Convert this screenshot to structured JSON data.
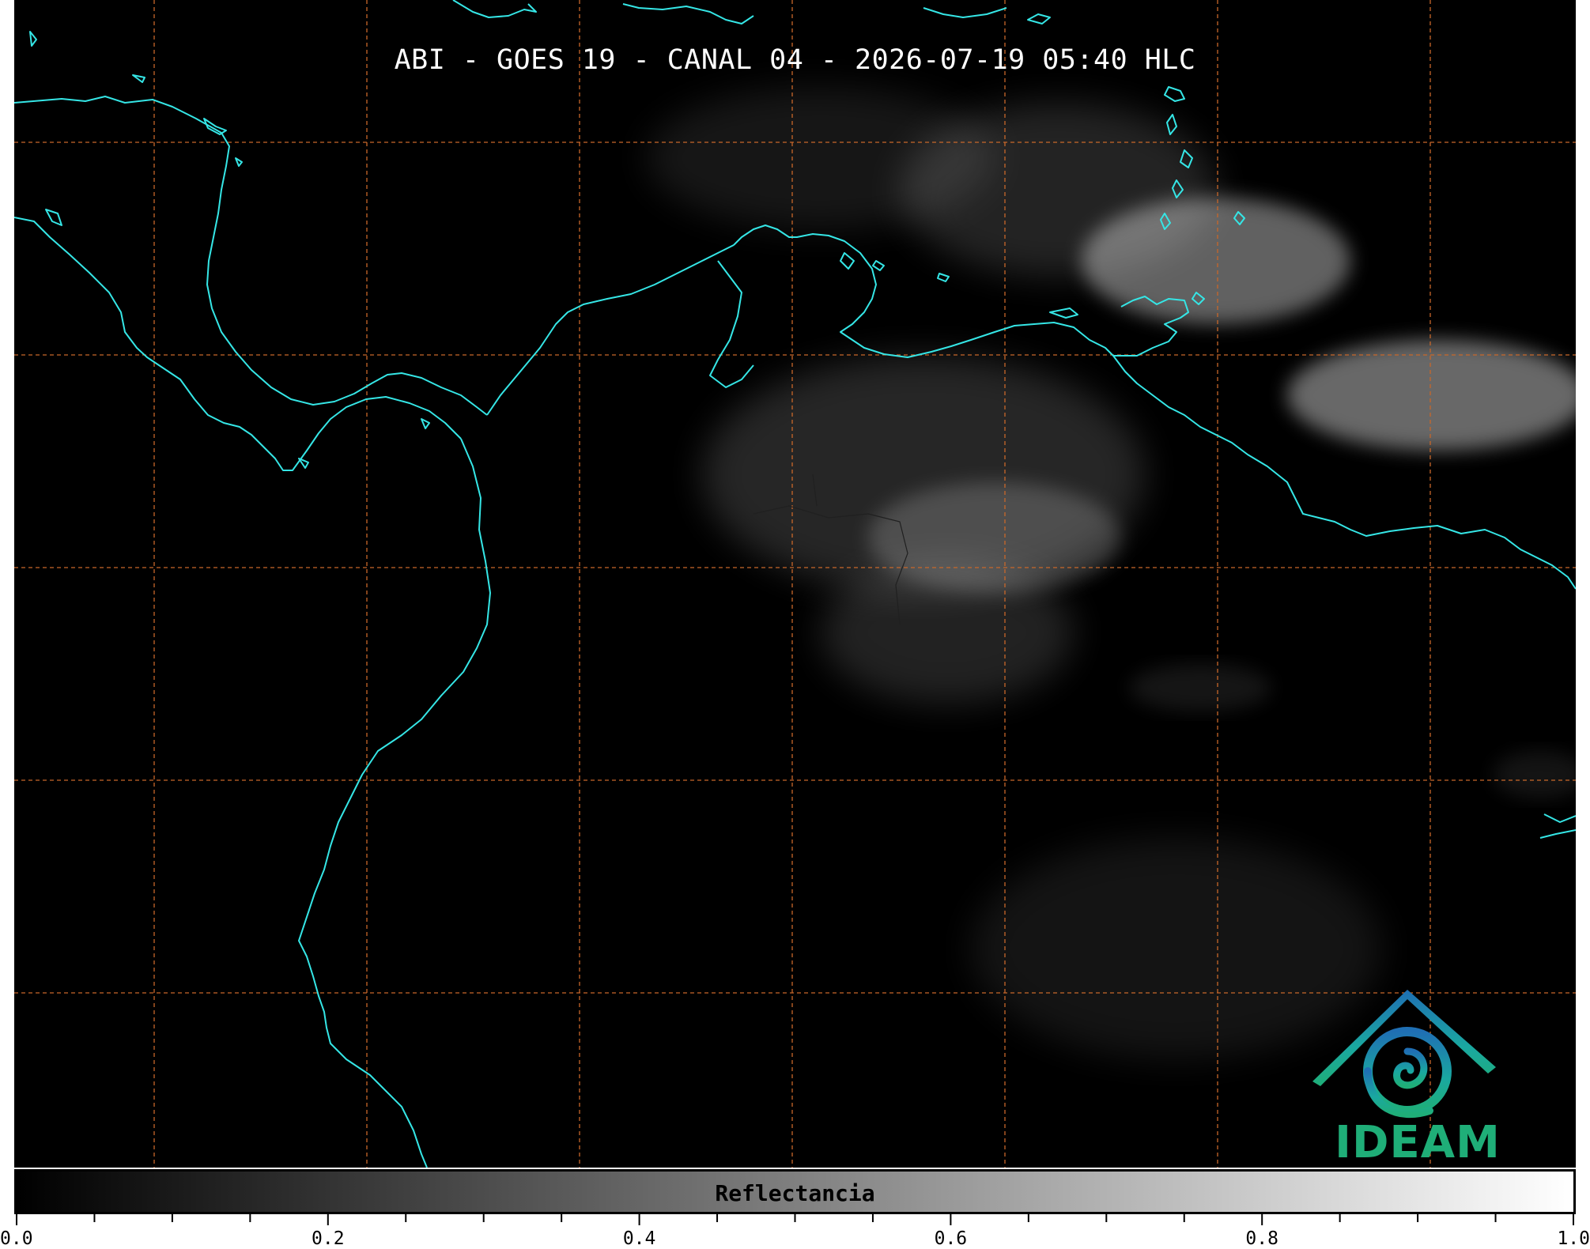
{
  "map": {
    "title": "ABI - GOES 19 - CANAL 04 - 2026-07-19 05:40 HLC",
    "background_color": "#000000",
    "coastline_color": "#35e6e6",
    "gridline_color": "#c8672a",
    "cloud_color": "#d9d9d9"
  },
  "logo": {
    "text": "IDEAM",
    "colors": [
      "#1f6fb4",
      "#1aa8a0",
      "#1fae78"
    ]
  },
  "colorbar": {
    "label": "Reflectancia",
    "min": 0.0,
    "max": 1.0,
    "gradient": [
      "#000000",
      "#ffffff"
    ],
    "tick_labels": [
      "0.0",
      "0.2",
      "0.4",
      "0.6",
      "0.8",
      "1.0"
    ]
  }
}
